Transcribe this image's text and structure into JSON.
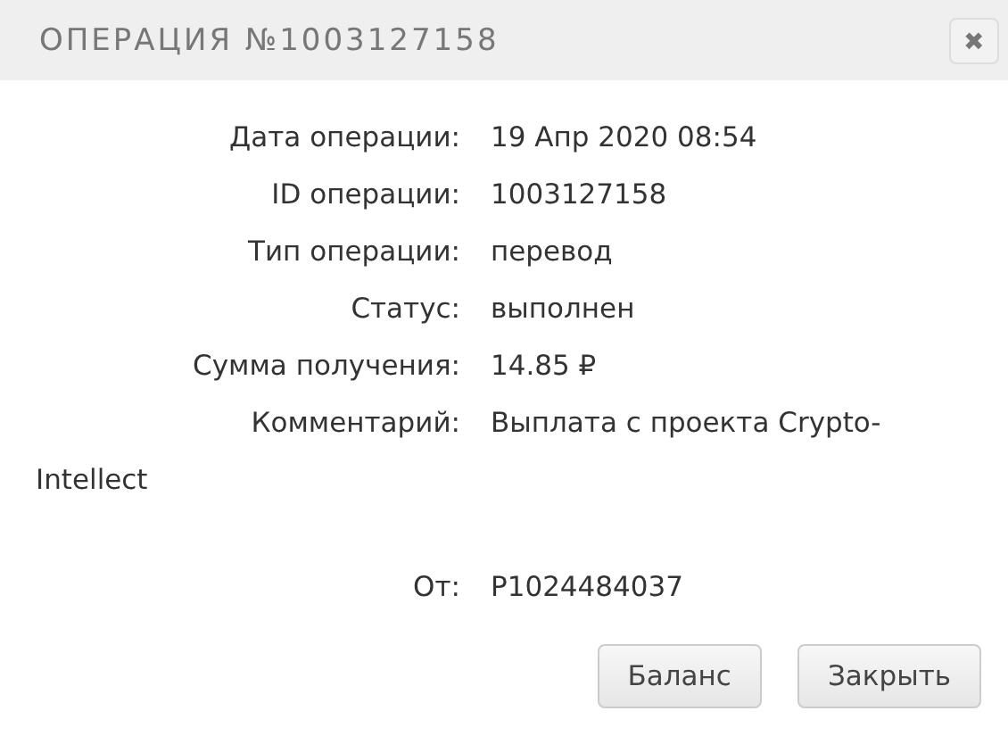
{
  "window": {
    "title": "ОПЕРАЦИЯ №1003127158",
    "close": "✖"
  },
  "fields": [
    {
      "label": "Дата операции:",
      "value": "19 Апр 2020 08:54"
    },
    {
      "label": "ID операции:",
      "value": "1003127158"
    },
    {
      "label": "Тип операции:",
      "value": "перевод"
    },
    {
      "label": "Статус:",
      "value": "выполнен"
    },
    {
      "label": "Сумма получения:",
      "value": "14.85 ₽"
    },
    {
      "label": "Комментарий:",
      "value": "Выплата с проекта Crypto-",
      "continuation": "Intellect"
    }
  ],
  "sender": {
    "label": "От:",
    "value": "P1024484037"
  },
  "buttons": [
    "Баланс",
    "Закрыть"
  ]
}
